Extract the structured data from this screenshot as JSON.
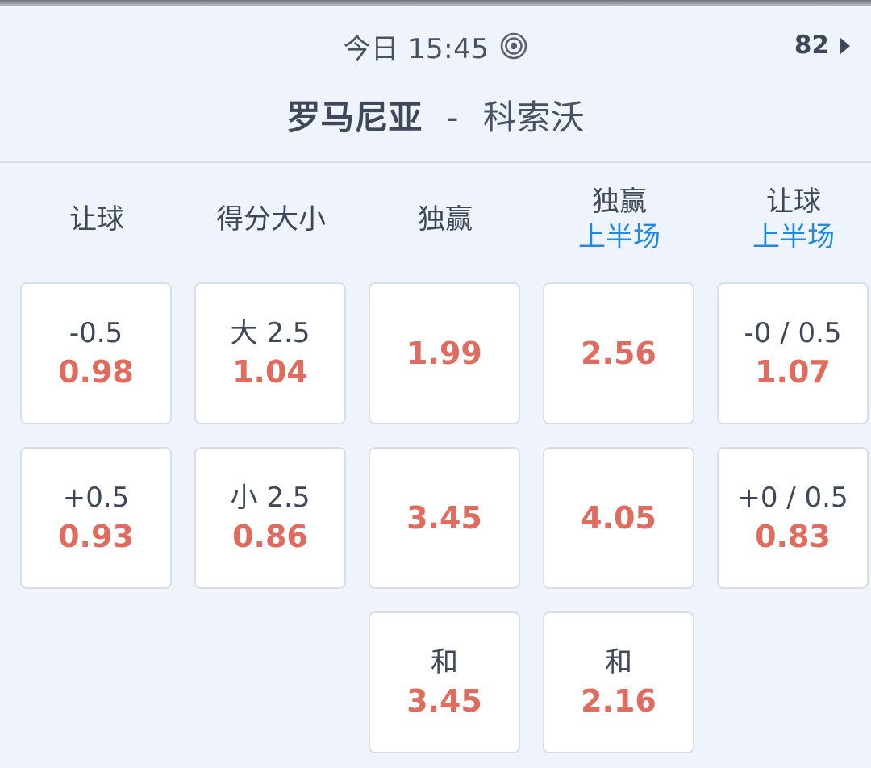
{
  "header": {
    "time_label": "今日 15:45",
    "live_icon": "radar-live-icon",
    "more_count": "82",
    "home_team": "罗马尼亚",
    "separator": "-",
    "away_team": "科索沃"
  },
  "columns": [
    {
      "title": "让球",
      "sub": ""
    },
    {
      "title": "得分大小",
      "sub": ""
    },
    {
      "title": "独赢",
      "sub": ""
    },
    {
      "title": "独赢",
      "sub": "上半场"
    },
    {
      "title": "让球",
      "sub": "上半场"
    }
  ],
  "markets": {
    "handicap": [
      {
        "line": "-0.5",
        "odds": "0.98"
      },
      {
        "line": "+0.5",
        "odds": "0.93"
      }
    ],
    "total": [
      {
        "line": "大 2.5",
        "odds": "1.04"
      },
      {
        "line": "小 2.5",
        "odds": "0.86"
      }
    ],
    "moneyline": [
      {
        "line": "",
        "odds": "1.99"
      },
      {
        "line": "",
        "odds": "3.45"
      },
      {
        "line": "和",
        "odds": "3.45"
      }
    ],
    "moneyline_1h": [
      {
        "line": "",
        "odds": "2.56"
      },
      {
        "line": "",
        "odds": "4.05"
      },
      {
        "line": "和",
        "odds": "2.16"
      }
    ],
    "handicap_1h": [
      {
        "line": "-0 / 0.5",
        "odds": "1.07"
      },
      {
        "line": "+0 / 0.5",
        "odds": "0.83"
      }
    ]
  },
  "colors": {
    "background": "#eff3fb",
    "odds": "#e06c5f",
    "accent_blue": "#1f8ae0",
    "text": "#3f4859"
  }
}
